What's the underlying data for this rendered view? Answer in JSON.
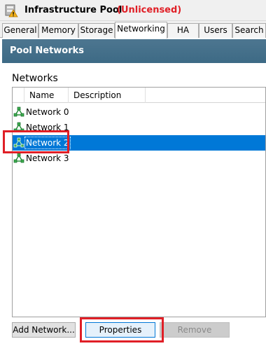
{
  "window": {
    "title": "Infrastructure Pool",
    "license_status": "(Unlicensed)",
    "icon": "pool-warning-icon"
  },
  "tabs": [
    {
      "label": "General",
      "active": false
    },
    {
      "label": "Memory",
      "active": false
    },
    {
      "label": "Storage",
      "active": false
    },
    {
      "label": "Networking",
      "active": true
    },
    {
      "label": "HA",
      "active": false
    },
    {
      "label": "Users",
      "active": false
    },
    {
      "label": "Search",
      "active": false
    }
  ],
  "panel": {
    "title": "Pool Networks",
    "section_label": "Networks"
  },
  "table": {
    "columns": [
      "Name",
      "Description"
    ],
    "rows": [
      {
        "name": "Network 0",
        "description": "",
        "selected": false,
        "icon": "network-icon"
      },
      {
        "name": "Network 1",
        "description": "",
        "selected": false,
        "icon": "network-icon"
      },
      {
        "name": "Network 2",
        "description": "",
        "selected": true,
        "icon": "network-icon"
      },
      {
        "name": "Network 3",
        "description": "",
        "selected": false,
        "icon": "network-icon"
      }
    ]
  },
  "buttons": {
    "add": "Add Network...",
    "properties": "Properties",
    "remove": "Remove"
  },
  "colors": {
    "header_band": "#3f6c87",
    "selection": "#0078d7",
    "license_warning": "#e01f26",
    "annotation_highlight": "#e01f26"
  }
}
